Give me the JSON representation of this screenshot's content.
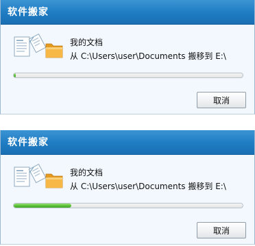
{
  "dialogs": [
    {
      "title": "软件搬家",
      "item_name": "我的文档",
      "move_text": "从 C:\\Users\\user\\Documents 搬移到 E:\\",
      "progress": 0.01,
      "cancel_label": "取消"
    },
    {
      "title": "软件搬家",
      "item_name": "我的文档",
      "move_text": "从 C:\\Users\\user\\Documents 搬移到 E:\\",
      "progress": 0.25,
      "cancel_label": "取消"
    }
  ],
  "colors": {
    "titlebar": "#1f7cc3",
    "progress": "#5fc13b",
    "folder": "#f0a93a"
  },
  "icons": [
    "document-icon",
    "folder-icon"
  ]
}
